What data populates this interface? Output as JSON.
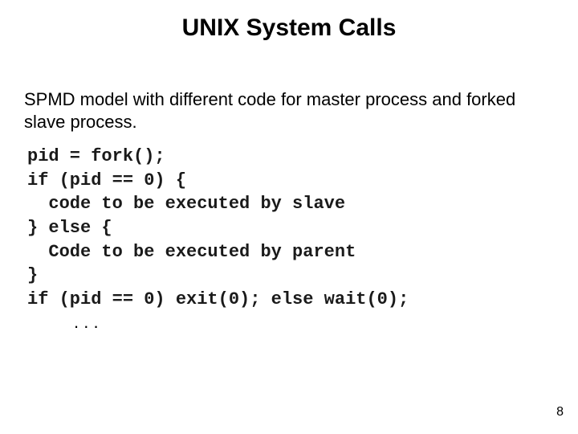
{
  "title": "UNIX System Calls",
  "body": "SPMD model with different code for master process and forked slave process.",
  "code": {
    "l1": "pid = fork();",
    "l2": "if (pid == 0) {",
    "l3": "  code to be executed by slave",
    "l4": "} else {",
    "l5": "  Code to be executed by parent",
    "l6": "}",
    "l7": "if (pid == 0) exit(0); else wait(0);"
  },
  "ellipsis": ".\n.\n.",
  "page_number": "8"
}
